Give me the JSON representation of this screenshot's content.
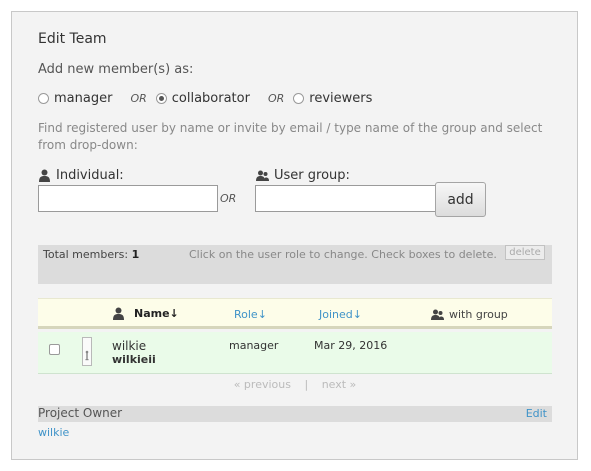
{
  "panel": {
    "title": "Edit Team",
    "add_as_label": "Add new member(s) as:",
    "roles": [
      {
        "label": "manager",
        "checked": false
      },
      {
        "label": "collaborator",
        "checked": true
      },
      {
        "label": "reviewers",
        "checked": false
      }
    ],
    "or_text": "OR",
    "help_text": "Find registered user by name or invite by email / type name of the group and select from drop-down:",
    "individual_label": "Individual:",
    "individual_value": "",
    "user_group_label": "User group:",
    "user_group_value": "",
    "add_button": "add"
  },
  "members": {
    "total_label": "Total members:",
    "total_count": "1",
    "hint": "Click on the user role to change. Check boxes to delete.",
    "delete_button": "delete"
  },
  "table": {
    "headers": {
      "name": "Name↓",
      "role": "Role↓",
      "joined": "Joined↓",
      "group": "with group"
    },
    "rows": [
      {
        "name": "wilkie",
        "username": "wilkieii",
        "role": "manager",
        "joined": "Mar 29, 2016",
        "group": ""
      }
    ]
  },
  "pager": {
    "previous": "« previous",
    "separator": "|",
    "next": "next »"
  },
  "owner": {
    "title": "Project Owner",
    "edit": "Edit",
    "name": "wilkie"
  },
  "colors": {
    "link": "#3f93c8",
    "row_bg": "#eafbe9",
    "header_bg": "#fdfde9",
    "panel_bg": "#f3f3f3"
  }
}
